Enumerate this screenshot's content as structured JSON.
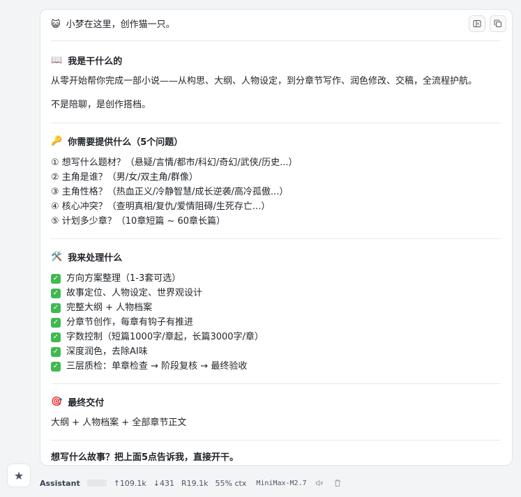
{
  "greeting": {
    "emoji": "😺",
    "text": "小梦在这里，创作猫一只。"
  },
  "sections": {
    "what": {
      "emoji": "📖",
      "title": "我是干什么的",
      "p1": "从零开始帮你完成一部小说——从构思、大纲、人物设定，到分章节写作、润色修改、交稿，全流程护航。",
      "p2": "不是陪聊，是创作搭档。"
    },
    "need": {
      "emoji": "🔑",
      "title": "你需要提供什么（5个问题）",
      "items": [
        "① 想写什么题材？（悬疑/言情/都市/科幻/奇幻/武侠/历史...）",
        "② 主角是谁？（男/女/双主角/群像）",
        "③ 主角性格？（热血正义/冷静智慧/成长逆袭/高冷孤傲...）",
        "④ 核心冲突？（查明真相/复仇/爱情阻碍/生死存亡...）",
        "⑤ 计划多少章？（10章短篇 ~ 60章长篇）"
      ]
    },
    "handle": {
      "emoji": "🛠️",
      "title": "我来处理什么",
      "items": [
        "方向方案整理（1-3套可选）",
        "故事定位、人物设定、世界观设计",
        "完整大纲 + 人物档案",
        "分章节创作，每章有钩子有推进",
        "字数控制（短篇1000字/章起，长篇3000字/章）",
        "深度润色，去除AI味",
        "三层质检：单章检查 → 阶段复核 → 最终验收"
      ]
    },
    "deliver": {
      "emoji": "🎯",
      "title": "最终交付",
      "text": "大纲 + 人物档案 + 全部章节正文"
    },
    "closing": "想写什么故事？把上面5点告诉我，直接开干。"
  },
  "meta": {
    "role": "Assistant",
    "tokens_in": "↑109.1k",
    "tokens_out": "↓431",
    "reasoning": "R19.1k",
    "ctx": "55% ctx",
    "model": "MiniMax-M2.7"
  },
  "icons": {
    "split": "split-view-icon",
    "copy": "copy-icon",
    "speaker": "speaker-icon",
    "trash": "trash-icon",
    "star": "star-icon"
  },
  "colors": {
    "check": "#3fb950",
    "card_bg": "#ffffff",
    "page_bg": "#f3f4f6"
  }
}
